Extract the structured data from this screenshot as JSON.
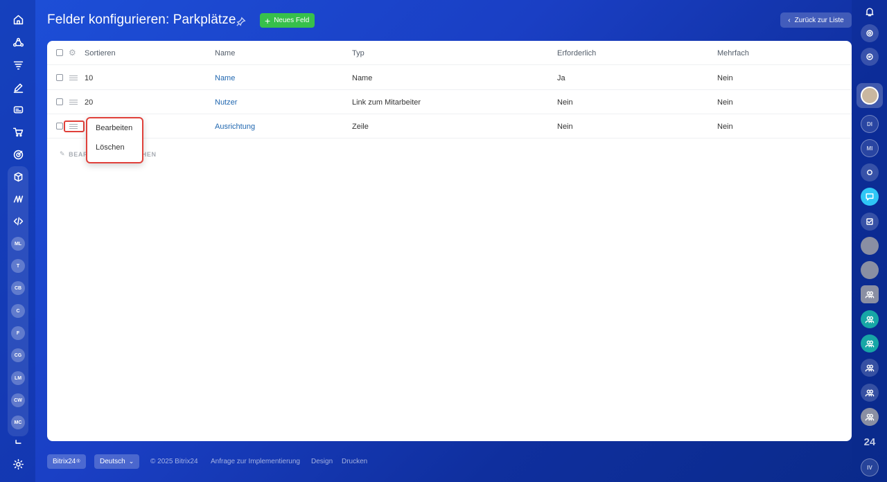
{
  "header": {
    "title": "Felder konfigurieren: Parkplätze",
    "new_field_label": "Neues Feld",
    "back_label": "Zurück zur Liste"
  },
  "table": {
    "columns": [
      "Sortieren",
      "Name",
      "Typ",
      "Erforderlich",
      "Mehrfach"
    ],
    "rows": [
      {
        "sort": "10",
        "name": "Name",
        "type": "Name",
        "required": "Ja",
        "multiple": "Nein"
      },
      {
        "sort": "20",
        "name": "Nutzer",
        "type": "Link zum Mitarbeiter",
        "required": "Nein",
        "multiple": "Nein"
      },
      {
        "sort": "",
        "name": "Ausrichtung",
        "type": "Zeile",
        "required": "Nein",
        "multiple": "Nein"
      }
    ],
    "bulk_action_visible": "BEAR",
    "bulk_action_visible_2": "SCHEN"
  },
  "context_menu": {
    "items": [
      "Bearbeiten",
      "Löschen"
    ]
  },
  "left_sidebar": {
    "avatars": [
      "ML",
      "T",
      "CB",
      "C",
      "F",
      "CG",
      "LM",
      "CW",
      "MC"
    ]
  },
  "right_sidebar": {
    "initials": [
      "DI",
      "MI",
      "IV"
    ],
    "badge_24": "24"
  },
  "footer": {
    "brand": "Bitrix24",
    "language": "Deutsch",
    "copyright": "© 2025 Bitrix24",
    "links": [
      "Anfrage zur Implementierung",
      "Design",
      "Drucken"
    ]
  },
  "colors": {
    "accent_green": "#37c04b",
    "link_blue": "#2067b0",
    "highlight_red": "#e0403a"
  }
}
